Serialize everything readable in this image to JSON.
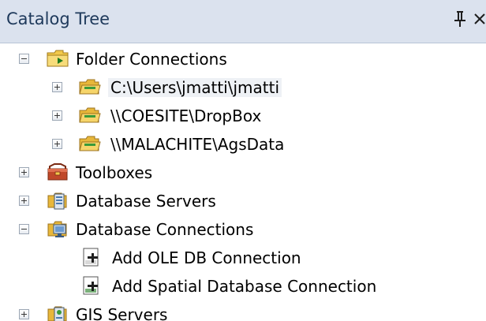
{
  "panel": {
    "title": "Catalog Tree",
    "pin_icon": "pin-icon",
    "close_icon": "close-icon"
  },
  "tree": {
    "folder_connections": {
      "label": "Folder Connections",
      "state": "expanded",
      "children": [
        {
          "label": "C:\\Users\\jmatti\\jmatti",
          "state": "collapsed"
        },
        {
          "label": "\\\\COESITE\\DropBox",
          "state": "collapsed"
        },
        {
          "label": "\\\\MALACHITE\\AgsData",
          "state": "collapsed"
        }
      ]
    },
    "toolboxes": {
      "label": "Toolboxes",
      "state": "collapsed"
    },
    "database_servers": {
      "label": "Database Servers",
      "state": "collapsed"
    },
    "database_connections": {
      "label": "Database Connections",
      "state": "expanded",
      "children": [
        {
          "label": "Add OLE DB Connection"
        },
        {
          "label": "Add Spatial Database Connection"
        }
      ]
    },
    "gis_servers": {
      "label": "GIS Servers",
      "state": "collapsed"
    }
  },
  "colors": {
    "titlebar_bg": "#dbe2ee",
    "title_text": "#1e395b",
    "folder_yellow": "#f2c94c"
  }
}
